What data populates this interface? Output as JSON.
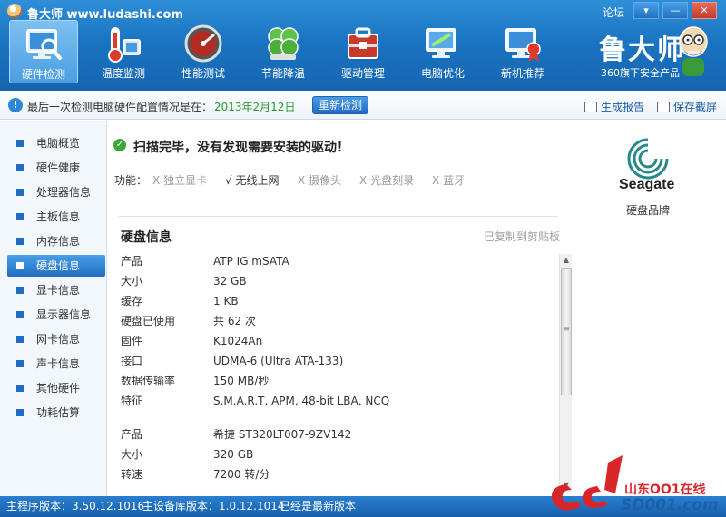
{
  "window": {
    "title": "鲁大师 www.ludashi.com",
    "forum": "论坛",
    "menu_btn": "▾",
    "minimize_btn": "—",
    "close_btn": "✕"
  },
  "nav": [
    {
      "label": "硬件检测",
      "icon": "monitor-magnifier-icon",
      "active": true
    },
    {
      "label": "温度监测",
      "icon": "thermometer-icon",
      "active": false
    },
    {
      "label": "性能测试",
      "icon": "speedometer-icon",
      "active": false
    },
    {
      "label": "节能降温",
      "icon": "clover-icon",
      "active": false
    },
    {
      "label": "驱动管理",
      "icon": "toolbox-icon",
      "active": false
    },
    {
      "label": "电脑优化",
      "icon": "screen-broom-icon",
      "active": false
    },
    {
      "label": "新机推荐",
      "icon": "monitor-badge-icon",
      "active": false
    }
  ],
  "brand": {
    "name": "鲁大师",
    "tagline": "360旗下安全产品"
  },
  "info_bar": {
    "text": "最后一次检测电脑硬件配置情况是在：",
    "date": "2013年2月12日",
    "recheck": "重新检测",
    "report": "生成报告",
    "screenshot": "保存截屏"
  },
  "sidebar": {
    "items": [
      {
        "label": "电脑概览",
        "active": false
      },
      {
        "label": "硬件健康",
        "active": false
      },
      {
        "label": "处理器信息",
        "active": false
      },
      {
        "label": "主板信息",
        "active": false
      },
      {
        "label": "内存信息",
        "active": false
      },
      {
        "label": "硬盘信息",
        "active": true
      },
      {
        "label": "显卡信息",
        "active": false
      },
      {
        "label": "显示器信息",
        "active": false
      },
      {
        "label": "网卡信息",
        "active": false
      },
      {
        "label": "声卡信息",
        "active": false
      },
      {
        "label": "其他硬件",
        "active": false
      },
      {
        "label": "功耗估算",
        "active": false
      }
    ]
  },
  "main": {
    "scan_message": "扫描完毕，没有发现需要安装的驱动！",
    "features_label": "功能：",
    "features": [
      {
        "mark": "X",
        "label": "独立显卡",
        "enabled": false
      },
      {
        "mark": "√",
        "label": "无线上网",
        "enabled": true
      },
      {
        "mark": "X",
        "label": "摄像头",
        "enabled": false
      },
      {
        "mark": "X",
        "label": "光盘刻录",
        "enabled": false
      },
      {
        "mark": "X",
        "label": "蓝牙",
        "enabled": false
      }
    ],
    "section_title": "硬盘信息",
    "copied_note": "已复制到剪贴板",
    "rows": [
      {
        "k": "产品",
        "v": "ATP IG mSATA"
      },
      {
        "k": "大小",
        "v": "32 GB"
      },
      {
        "k": "缓存",
        "v": "1 KB"
      },
      {
        "k": "硬盘已使用",
        "v": "共 62 次"
      },
      {
        "k": "固件",
        "v": "K1024An"
      },
      {
        "k": "接口",
        "v": "UDMA-6 (Ultra ATA-133)"
      },
      {
        "k": "数据传输率",
        "v": "150 MB/秒"
      },
      {
        "k": "特征",
        "v": "S.M.A.R.T,  APM,  48-bit LBA,  NCQ"
      },
      {
        "k": "",
        "v": ""
      },
      {
        "k": "产品",
        "v": "希捷 ST320LT007-9ZV142"
      },
      {
        "k": "大小",
        "v": "320 GB"
      },
      {
        "k": "转速",
        "v": "7200 转/分"
      }
    ]
  },
  "brand_panel": {
    "logo_text": "Seagate",
    "label": "硬盘品牌"
  },
  "status_bar": {
    "version": "主程序版本：3.50.12.1016",
    "db_version": "主设备库版本：1.0.12.1014",
    "latest": "已经是最新版本"
  },
  "watermark": {
    "line1": "山东OO1在线",
    "line2": "SD001.com"
  }
}
